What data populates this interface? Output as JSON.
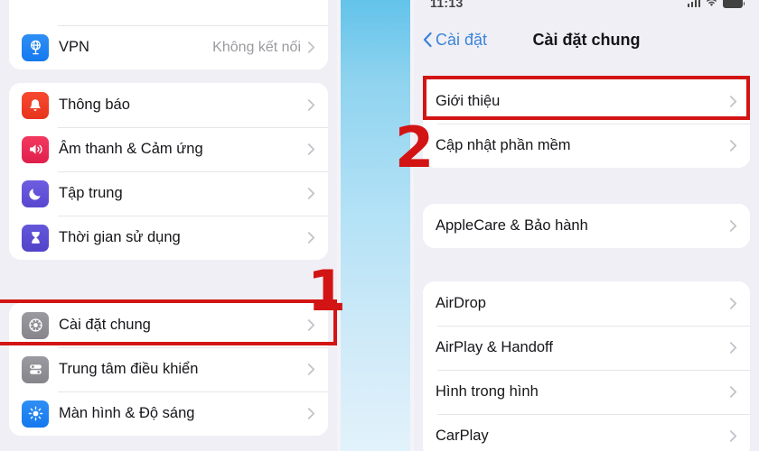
{
  "annotations": {
    "step1": "1",
    "step2": "2",
    "highlight_color": "#d31414"
  },
  "left_phone": {
    "groups": [
      {
        "name": "vpn-group",
        "rows": [
          {
            "label": "VPN",
            "value": "Không kết nối",
            "icon": "vpn-globe-icon",
            "icon_class": "ic-vpn"
          }
        ]
      },
      {
        "name": "notifications-group",
        "rows": [
          {
            "label": "Thông báo",
            "value": "",
            "icon": "bell-icon",
            "icon_class": "ic-notif"
          },
          {
            "label": "Âm thanh & Cảm ứng",
            "value": "",
            "icon": "speaker-icon",
            "icon_class": "ic-sound"
          },
          {
            "label": "Tập trung",
            "value": "",
            "icon": "moon-icon",
            "icon_class": "ic-focus"
          },
          {
            "label": "Thời gian sử dụng",
            "value": "",
            "icon": "hourglass-icon",
            "icon_class": "ic-screen"
          }
        ]
      },
      {
        "name": "general-group",
        "rows": [
          {
            "label": "Cài đặt chung",
            "value": "",
            "icon": "gear-icon",
            "icon_class": "ic-general"
          },
          {
            "label": "Trung tâm điều khiển",
            "value": "",
            "icon": "sliders-icon",
            "icon_class": "ic-control"
          },
          {
            "label": "Màn hình & Độ sáng",
            "value": "",
            "icon": "brightness-sun-icon",
            "icon_class": "ic-display"
          }
        ]
      }
    ]
  },
  "right_phone": {
    "status_bar": {
      "time": "11:13",
      "icons": [
        "cellular-signal-icon",
        "wifi-icon",
        "battery-icon"
      ]
    },
    "nav": {
      "back_label": "Cài đặt",
      "title": "Cài đặt chung"
    },
    "groups": [
      {
        "name": "about-group",
        "rows": [
          {
            "label": "Giới thiệu"
          },
          {
            "label": "Cập nhật phần mềm"
          }
        ]
      },
      {
        "name": "applecare-group",
        "rows": [
          {
            "label": "AppleCare & Bảo hành"
          }
        ]
      },
      {
        "name": "airdrop-group",
        "rows": [
          {
            "label": "AirDrop"
          },
          {
            "label": "AirPlay & Handoff"
          },
          {
            "label": "Hình trong hình"
          },
          {
            "label": "CarPlay"
          }
        ]
      }
    ]
  }
}
